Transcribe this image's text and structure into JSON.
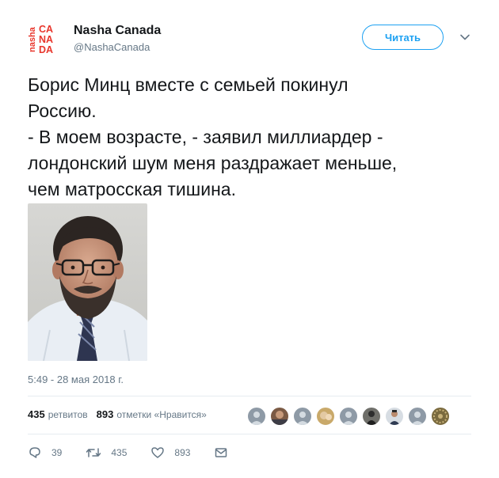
{
  "author": {
    "name": "Nasha Canada",
    "handle": "@NashaCanada",
    "logo_text": "nasha CANADA"
  },
  "follow_button": {
    "label": "Читать"
  },
  "tweet": {
    "lines": [
      "Борис Минц вместе с семьей покинул",
      "Россию.",
      "- В моем возрасте, - заявил миллиардер -",
      "лондонский шум меня раздражает меньше,",
      "чем матросская тишина."
    ],
    "timestamp": "5:49 - 28 мая 2018 г."
  },
  "stats": {
    "retweets": {
      "count": "435",
      "label": "ретвитов"
    },
    "likes": {
      "count": "893",
      "label": "отметки «Нравится»"
    }
  },
  "actions": {
    "reply_count": "39",
    "retweet_count": "435",
    "like_count": "893"
  },
  "colors": {
    "accent": "#1da1f2",
    "brand_red": "#e8362c",
    "text": "#14171a",
    "muted": "#657786",
    "divider": "#e6ecf0"
  },
  "icons": [
    "chevron-down-icon",
    "reply-icon",
    "retweet-icon",
    "heart-icon",
    "message-icon"
  ]
}
